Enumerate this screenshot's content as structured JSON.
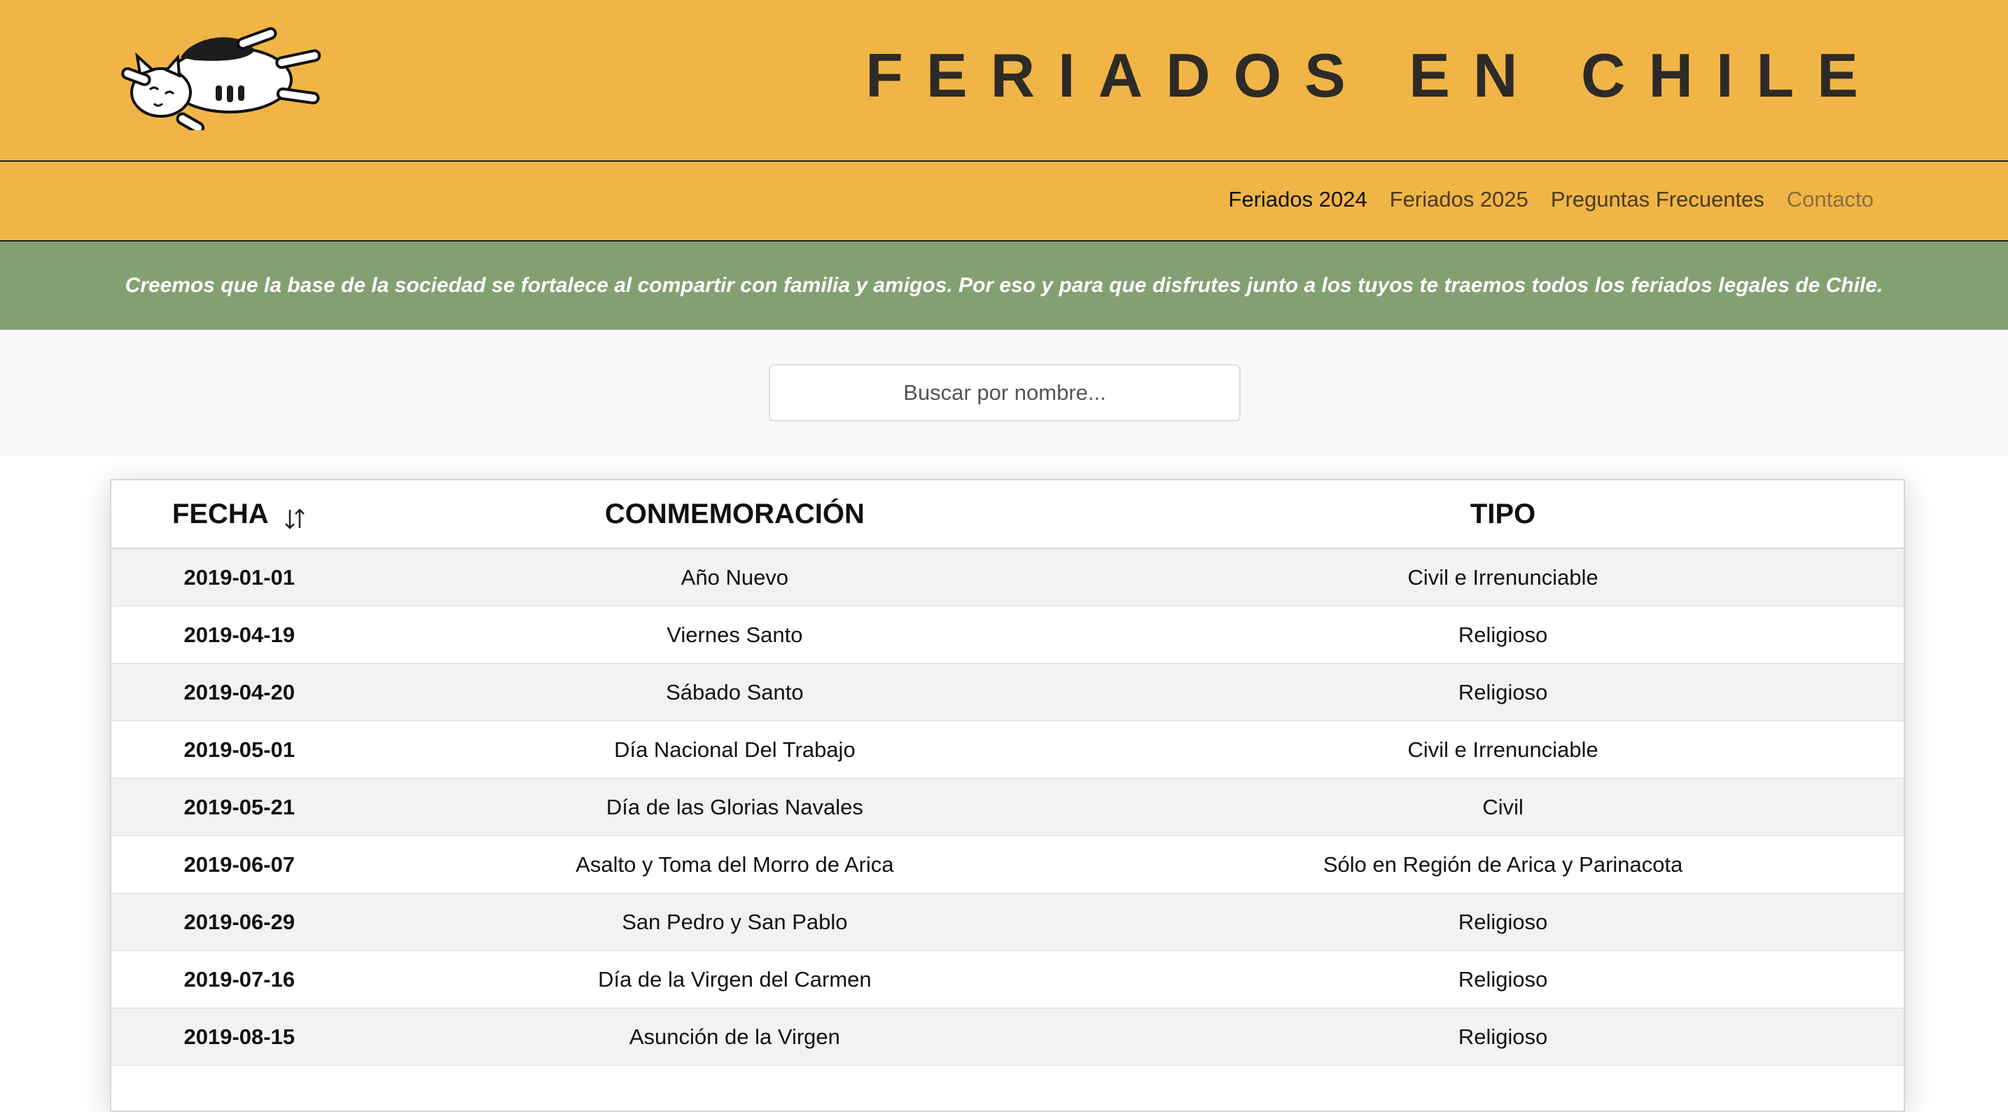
{
  "header": {
    "title": "FERIADOS EN CHILE",
    "logo_icon": "sleeping-cat-logo"
  },
  "nav": {
    "items": [
      {
        "label": "Feriados 2024"
      },
      {
        "label": "Feriados 2025"
      },
      {
        "label": "Preguntas Frecuentes"
      },
      {
        "label": "Contacto"
      }
    ]
  },
  "banner": {
    "text": "Creemos que la base de la sociedad se fortalece al compartir con familia y amigos. Por eso y para que disfrutes junto a los tuyos te traemos todos los feriados legales de Chile."
  },
  "search": {
    "placeholder": "Buscar por nombre..."
  },
  "table": {
    "headers": {
      "fecha": "FECHA",
      "conmemoracion": "CONMEMORACIÓN",
      "tipo": "TIPO"
    },
    "sort_icon": "sort-arrows-icon",
    "rows": [
      {
        "fecha": "2019-01-01",
        "conmemoracion": "Año Nuevo",
        "tipo": "Civil e Irrenunciable"
      },
      {
        "fecha": "2019-04-19",
        "conmemoracion": "Viernes Santo",
        "tipo": "Religioso"
      },
      {
        "fecha": "2019-04-20",
        "conmemoracion": "Sábado Santo",
        "tipo": "Religioso"
      },
      {
        "fecha": "2019-05-01",
        "conmemoracion": "Día Nacional Del Trabajo",
        "tipo": "Civil e Irrenunciable"
      },
      {
        "fecha": "2019-05-21",
        "conmemoracion": "Día de las Glorias Navales",
        "tipo": "Civil"
      },
      {
        "fecha": "2019-06-07",
        "conmemoracion": "Asalto y Toma del Morro de Arica",
        "tipo": "Sólo en Región de Arica y Parinacota"
      },
      {
        "fecha": "2019-06-29",
        "conmemoracion": "San Pedro y San Pablo",
        "tipo": "Religioso"
      },
      {
        "fecha": "2019-07-16",
        "conmemoracion": "Día de la Virgen del Carmen",
        "tipo": "Religioso"
      },
      {
        "fecha": "2019-08-15",
        "conmemoracion": "Asunción de la Virgen",
        "tipo": "Religioso"
      },
      {
        "fecha": "",
        "conmemoracion": "",
        "tipo": ""
      }
    ]
  },
  "colors": {
    "header_bg": "#f0b546",
    "banner_bg": "#83a073",
    "title_text": "#2d2a27"
  }
}
